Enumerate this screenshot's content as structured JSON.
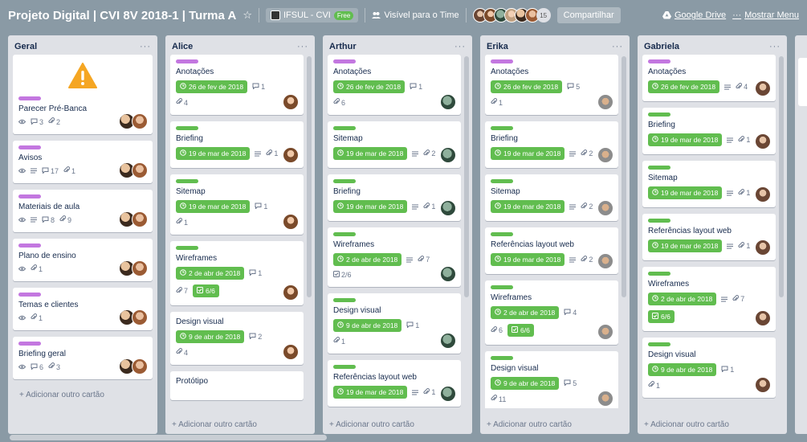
{
  "header": {
    "board_title": "Projeto Digital | CVI 8V 2018-1 | Turma A",
    "team_name": "IFSUL - CVI",
    "team_badge": "Free",
    "visibility": "Visível para o Time",
    "member_count": "15",
    "share_label": "Compartilhar",
    "drive_label": "Google Drive",
    "menu_label": "Mostrar Menu",
    "menu_ellipsis": "···"
  },
  "colors": {
    "board_bg": "#8a9aa5",
    "label_purple": "#c377e0",
    "label_green": "#61bd4f",
    "list_bg": "#dfe1e6"
  },
  "add_card_label": "+ Adicionar outro cartão",
  "lists": [
    {
      "name": "Geral",
      "cards": [
        {
          "label": "purple",
          "title": "Parecer Pré-Banca",
          "badges": {
            "comments": "3",
            "attachments": "2"
          },
          "warning": true
        },
        {
          "label": "purple",
          "title": "Avisos",
          "badges": {
            "comments": "17",
            "attachments": "1"
          }
        },
        {
          "label": "purple",
          "title": "Materiais de aula",
          "badges": {
            "comments": "8",
            "attachments": "9"
          }
        },
        {
          "label": "purple",
          "title": "Plano de ensino",
          "badges": {
            "attachments": "1"
          }
        },
        {
          "label": "purple",
          "title": "Temas e clientes",
          "badges": {
            "attachments": "1"
          }
        },
        {
          "label": "purple",
          "title": "Briefing geral",
          "badges": {
            "comments": "6",
            "attachments": "3"
          }
        }
      ]
    },
    {
      "name": "Alice",
      "cards": [
        {
          "label": "purple",
          "title": "Anotações",
          "due": "26 de fev de 2018",
          "badges": {
            "comments": "1",
            "attachments": "4"
          }
        },
        {
          "label": "green",
          "title": "Briefing",
          "due": "19 de mar de 2018",
          "badges": {
            "attachments": "1"
          }
        },
        {
          "label": "green",
          "title": "Sitemap",
          "due": "19 de mar de 2018",
          "badges": {
            "comments": "1",
            "attachments": "1"
          }
        },
        {
          "label": "green",
          "title": "Wireframes",
          "due": "2 de abr de 2018",
          "badges": {
            "comments": "1",
            "attachments": "7"
          },
          "checklist": "6/6"
        },
        {
          "label": "none",
          "title": "Design visual",
          "due": "9 de abr de 2018",
          "badges": {
            "comments": "2",
            "attachments": "4"
          }
        },
        {
          "label": "none",
          "title": "Protótipo"
        }
      ]
    },
    {
      "name": "Arthur",
      "cards": [
        {
          "label": "purple",
          "title": "Anotações",
          "due": "26 de fev de 2018",
          "badges": {
            "comments": "1",
            "attachments": "6"
          }
        },
        {
          "label": "green",
          "title": "Sitemap",
          "due": "19 de mar de 2018",
          "badges": {
            "attachments": "2"
          }
        },
        {
          "label": "green",
          "title": "Briefing",
          "due": "19 de mar de 2018",
          "badges": {
            "attachments": "1"
          }
        },
        {
          "label": "green",
          "title": "Wireframes",
          "due": "2 de abr de 2018",
          "badges": {
            "attachments": "7"
          },
          "checklist": "2/6"
        },
        {
          "label": "green",
          "title": "Design visual",
          "due": "9 de abr de 2018",
          "badges": {
            "comments": "1",
            "attachments": "1"
          }
        },
        {
          "label": "green",
          "title": "Referências layout web",
          "due": "19 de mar de 2018",
          "badges": {
            "attachments": "1"
          }
        }
      ]
    },
    {
      "name": "Erika",
      "cards": [
        {
          "label": "purple",
          "title": "Anotações",
          "due": "26 de fev de 2018",
          "badges": {
            "comments": "5",
            "attachments": "1"
          }
        },
        {
          "label": "green",
          "title": "Briefing",
          "due": "19 de mar de 2018",
          "badges": {
            "attachments": "2"
          }
        },
        {
          "label": "green",
          "title": "Sitemap",
          "due": "19 de mar de 2018",
          "badges": {
            "attachments": "2"
          }
        },
        {
          "label": "green",
          "title": "Referências layout web",
          "due": "19 de mar de 2018",
          "badges": {
            "attachments": "2"
          }
        },
        {
          "label": "green",
          "title": "Wireframes",
          "due": "2 de abr de 2018",
          "badges": {
            "comments": "4",
            "attachments": "6"
          },
          "checklist": "6/6"
        },
        {
          "label": "green",
          "title": "Design visual",
          "due": "9 de abr de 2018",
          "badges": {
            "comments": "5",
            "attachments": "11"
          }
        }
      ]
    },
    {
      "name": "Gabriela",
      "cards": [
        {
          "label": "purple",
          "title": "Anotações",
          "due": "26 de fev de 2018",
          "badges": {
            "attachments": "4"
          }
        },
        {
          "label": "green",
          "title": "Briefing",
          "due": "19 de mar de 2018",
          "badges": {
            "attachments": "1"
          }
        },
        {
          "label": "green",
          "title": "Sitemap",
          "due": "19 de mar de 2018",
          "badges": {
            "attachments": "1"
          }
        },
        {
          "label": "green",
          "title": "Referências layout web",
          "due": "19 de mar de 2018",
          "badges": {
            "attachments": "1"
          }
        },
        {
          "label": "green",
          "title": "Wireframes",
          "due": "2 de abr de 2018",
          "badges": {
            "attachments": "7"
          },
          "checklist": "6/6"
        },
        {
          "label": "green",
          "title": "Design visual",
          "due": "9 de abr de 2018",
          "badges": {
            "comments": "1",
            "attachments": "1"
          }
        }
      ]
    }
  ]
}
